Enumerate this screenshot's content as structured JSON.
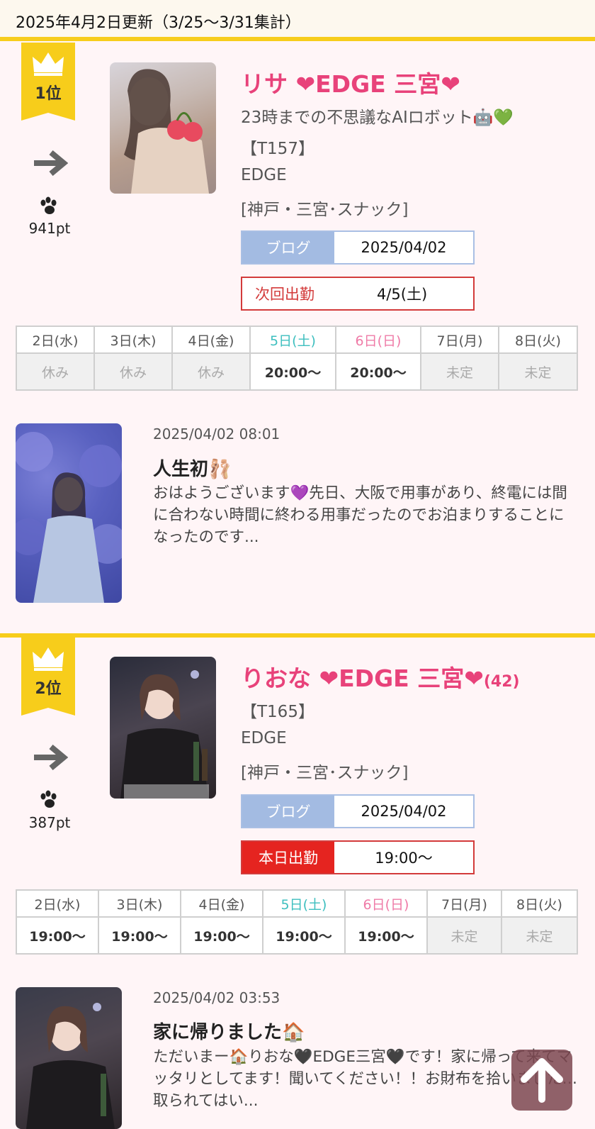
{
  "header": {
    "update_text": "2025年4月2日更新（3/25～3/31集計）"
  },
  "entries": [
    {
      "rank_label": "1位",
      "trend": "same",
      "points": "941pt",
      "name": "リサ ❤EDGE 三宮❤",
      "age": "",
      "catchphrase": "23時までの不思議なAIロボット🤖💚",
      "height": "【T157】",
      "shop": "EDGE",
      "area": "[神戸・三宮･スナック]",
      "blog_label": "ブログ",
      "blog_date": "2025/04/02",
      "next_label": "次回出勤",
      "next_value": "4/5(土)",
      "schedule": {
        "days": [
          "2日(水)",
          "3日(木)",
          "4日(金)",
          "5日(土)",
          "6日(日)",
          "7日(月)",
          "8日(火)"
        ],
        "shifts": [
          "休み",
          "休み",
          "休み",
          "20:00〜",
          "20:00〜",
          "未定",
          "未定"
        ]
      },
      "post": {
        "datetime": "2025/04/02 08:01",
        "title": "人生初🩰",
        "excerpt": "おはようございます💜先日、大阪で用事があり、終電には間に合わない時間に終わる用事だったのでお泊まりすることになったのです..."
      }
    },
    {
      "rank_label": "2位",
      "trend": "same",
      "points": "387pt",
      "name": "りおな ❤EDGE 三宮❤",
      "age": "(42)",
      "catchphrase": "",
      "height": "【T165】",
      "shop": "EDGE",
      "area": "[神戸・三宮･スナック]",
      "blog_label": "ブログ",
      "blog_date": "2025/04/02",
      "today_label": "本日出勤",
      "today_value": "19:00〜",
      "schedule": {
        "days": [
          "2日(水)",
          "3日(木)",
          "4日(金)",
          "5日(土)",
          "6日(日)",
          "7日(月)",
          "8日(火)"
        ],
        "shifts": [
          "19:00〜",
          "19:00〜",
          "19:00〜",
          "19:00〜",
          "19:00〜",
          "未定",
          "未定"
        ]
      },
      "post": {
        "datetime": "2025/04/02 03:53",
        "title": "家に帰りました🏠",
        "excerpt": "ただいまー🏠りおな🖤EDGE三宮🖤です！家に帰って来てマッタリとしてます！聞いてください！！お財布を拾いました…取られてはい..."
      }
    }
  ],
  "colors": {
    "accent_yellow": "#f7cd1b",
    "name_pink": "#e8427a",
    "saturday": "#3ebfbf",
    "sunday": "#ef7ba7",
    "today_red": "#e52420"
  },
  "icons": [
    "crown-icon",
    "arrow-right-icon",
    "paw-icon",
    "arrow-up-icon"
  ]
}
